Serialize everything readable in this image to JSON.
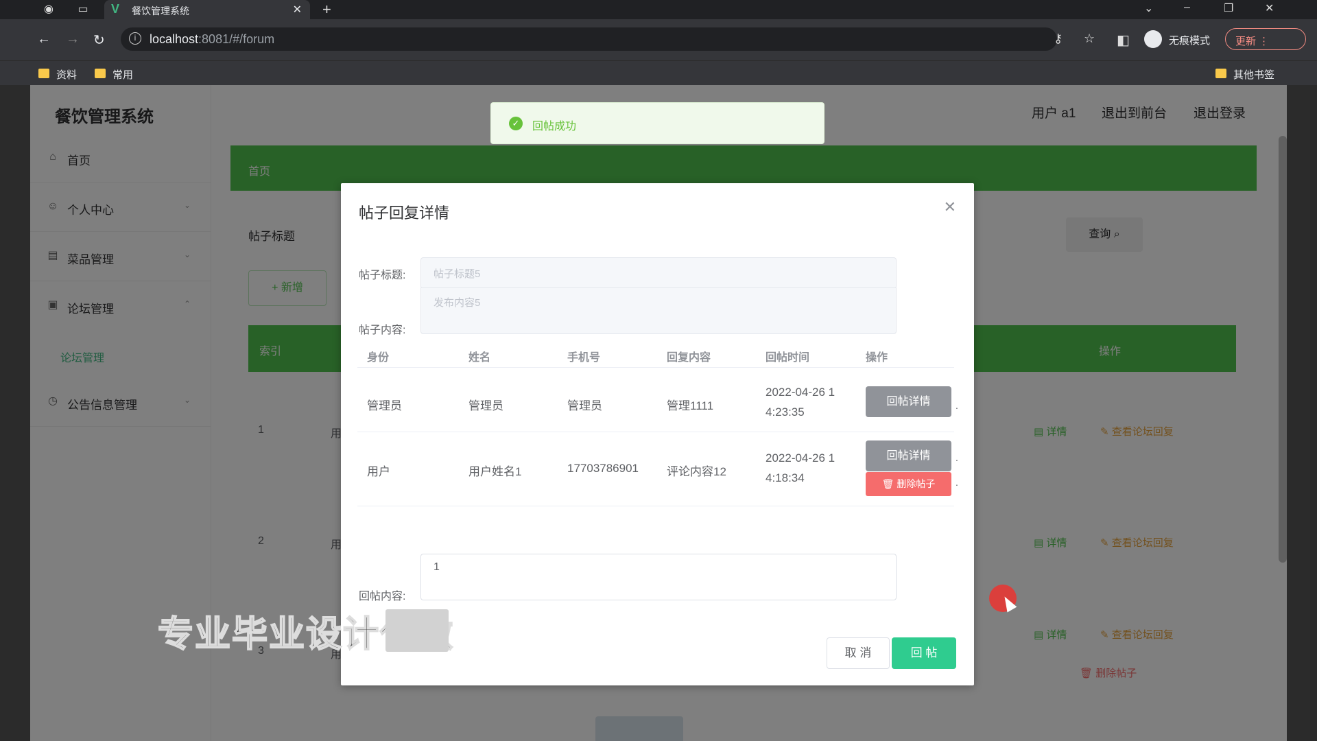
{
  "browser": {
    "tab_title": "餐饮管理系统",
    "url_host": "localhost",
    "url_rest": ":8081/#/forum",
    "incognito_label": "无痕模式",
    "update_label": "更新",
    "bookmarks": [
      "资料",
      "常用"
    ],
    "other_bookmarks": "其他书签"
  },
  "app": {
    "brand": "餐饮管理系统",
    "user": "用户 a1",
    "exit_front": "退出到前台",
    "logout": "退出登录",
    "menu": [
      {
        "label": "首页",
        "icon": "home-icon"
      },
      {
        "label": "个人中心",
        "icon": "user-icon"
      },
      {
        "label": "菜品管理",
        "icon": "menu-icon"
      },
      {
        "label": "论坛管理",
        "icon": "forum-icon"
      },
      {
        "label": "公告信息管理",
        "icon": "notice-icon"
      }
    ],
    "submenu_active": "论坛管理",
    "breadcrumb": "首页",
    "filter_label": "帖子标题",
    "query_label": "查询",
    "add_label": "+ 新增",
    "table_header_index": "索引",
    "table_header_action": "操作",
    "rows": [
      {
        "index": "1",
        "name": "用"
      },
      {
        "index": "2",
        "name": "用"
      },
      {
        "index": "3",
        "name": "用"
      }
    ],
    "row_detail": "详情",
    "row_view_replies": "查看论坛回复",
    "row_delete": "删除帖子"
  },
  "toast": {
    "message": "回帖成功"
  },
  "dialog": {
    "title": "帖子回复详情",
    "label_title": "帖子标题:",
    "value_title": "帖子标题5",
    "label_content": "帖子内容:",
    "value_content": "发布内容5",
    "columns": [
      "身份",
      "姓名",
      "手机号",
      "回复内容",
      "回帖时间",
      "操作"
    ],
    "replies": [
      {
        "role": "管理员",
        "name": "管理员",
        "phone": "管理员",
        "content": "管理1111",
        "time_line1": "2022-04-26 1",
        "time_line2": "4:23:35",
        "btn_detail": "回帖详情"
      },
      {
        "role": "用户",
        "name": "用户姓名1",
        "phone": "17703786901",
        "content": "评论内容12",
        "time_line1": "2022-04-26 1",
        "time_line2": "4:18:34",
        "btn_detail": "回帖详情",
        "btn_delete": "删除帖子"
      }
    ],
    "label_reply": "回帖内容:",
    "reply_value": "1",
    "cancel_label": "取 消",
    "submit_label": "回 帖"
  },
  "overlay": {
    "watermark": "专业毕业设计代做"
  }
}
